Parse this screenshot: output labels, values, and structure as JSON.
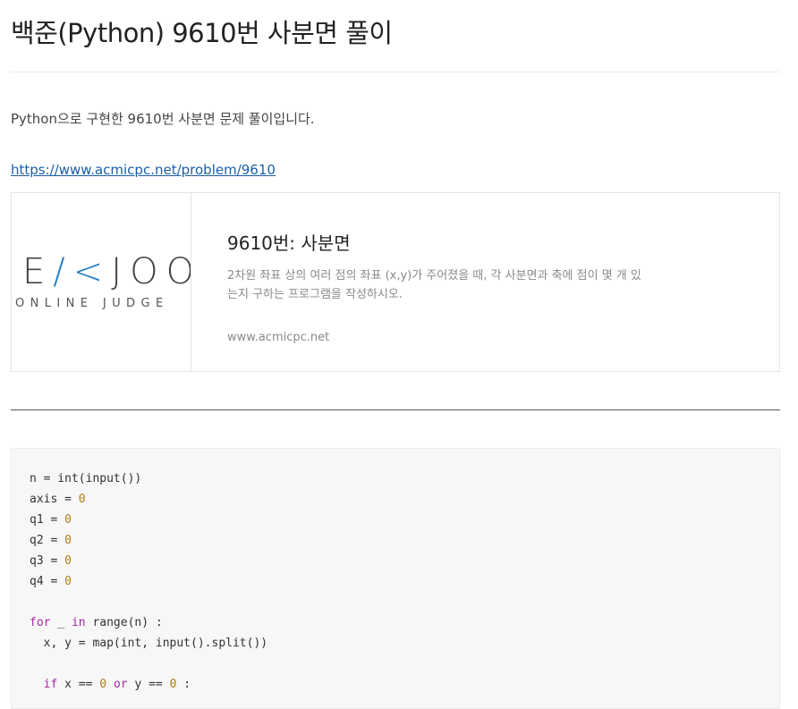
{
  "post": {
    "title": "백준(Python) 9610번 사분면 풀이",
    "intro": "Python으로 구현한 9610번 사분면 문제 풀이입니다.",
    "link_text": "https://www.acmicpc.net/problem/9610"
  },
  "card": {
    "logo_text_pre": "E",
    "logo_text_k": "/<",
    "logo_text_post": "JOO",
    "logo_sub": "ONLINE JUDGE",
    "title": "9610번: 사분면",
    "description": "2차원 좌표 상의 여러 점의 좌표 (x,y)가 주어졌을 때, 각 사분면과 축에 점이 몇 개 있는지 구하는 프로그램을 작성하시오.",
    "domain": "www.acmicpc.net"
  },
  "code": {
    "lines": [
      [
        {
          "t": "n = int(input())",
          "c": ""
        }
      ],
      [
        {
          "t": "axis = ",
          "c": ""
        },
        {
          "t": "0",
          "c": "num"
        }
      ],
      [
        {
          "t": "q1 = ",
          "c": ""
        },
        {
          "t": "0",
          "c": "num"
        }
      ],
      [
        {
          "t": "q2 = ",
          "c": ""
        },
        {
          "t": "0",
          "c": "num"
        }
      ],
      [
        {
          "t": "q3 = ",
          "c": ""
        },
        {
          "t": "0",
          "c": "num"
        }
      ],
      [
        {
          "t": "q4 = ",
          "c": ""
        },
        {
          "t": "0",
          "c": "num"
        }
      ],
      [
        {
          "t": "",
          "c": ""
        }
      ],
      [
        {
          "t": "for",
          "c": "kw"
        },
        {
          "t": " _ ",
          "c": ""
        },
        {
          "t": "in",
          "c": "kw"
        },
        {
          "t": " range(n) :",
          "c": ""
        }
      ],
      [
        {
          "t": "  x, y = map(int, input().split())",
          "c": ""
        }
      ],
      [
        {
          "t": "",
          "c": ""
        }
      ],
      [
        {
          "t": "  ",
          "c": ""
        },
        {
          "t": "if",
          "c": "kw"
        },
        {
          "t": " x == ",
          "c": ""
        },
        {
          "t": "0",
          "c": "num"
        },
        {
          "t": " ",
          "c": ""
        },
        {
          "t": "or",
          "c": "kw"
        },
        {
          "t": " y == ",
          "c": ""
        },
        {
          "t": "0",
          "c": "num"
        },
        {
          "t": " :",
          "c": ""
        }
      ]
    ]
  },
  "colors": {
    "link": "#1a5fa8",
    "logo_accent": "#1f7fc4",
    "code_keyword": "#a626a4",
    "code_number": "#b07c16",
    "code_background": "#f7f7f7"
  }
}
